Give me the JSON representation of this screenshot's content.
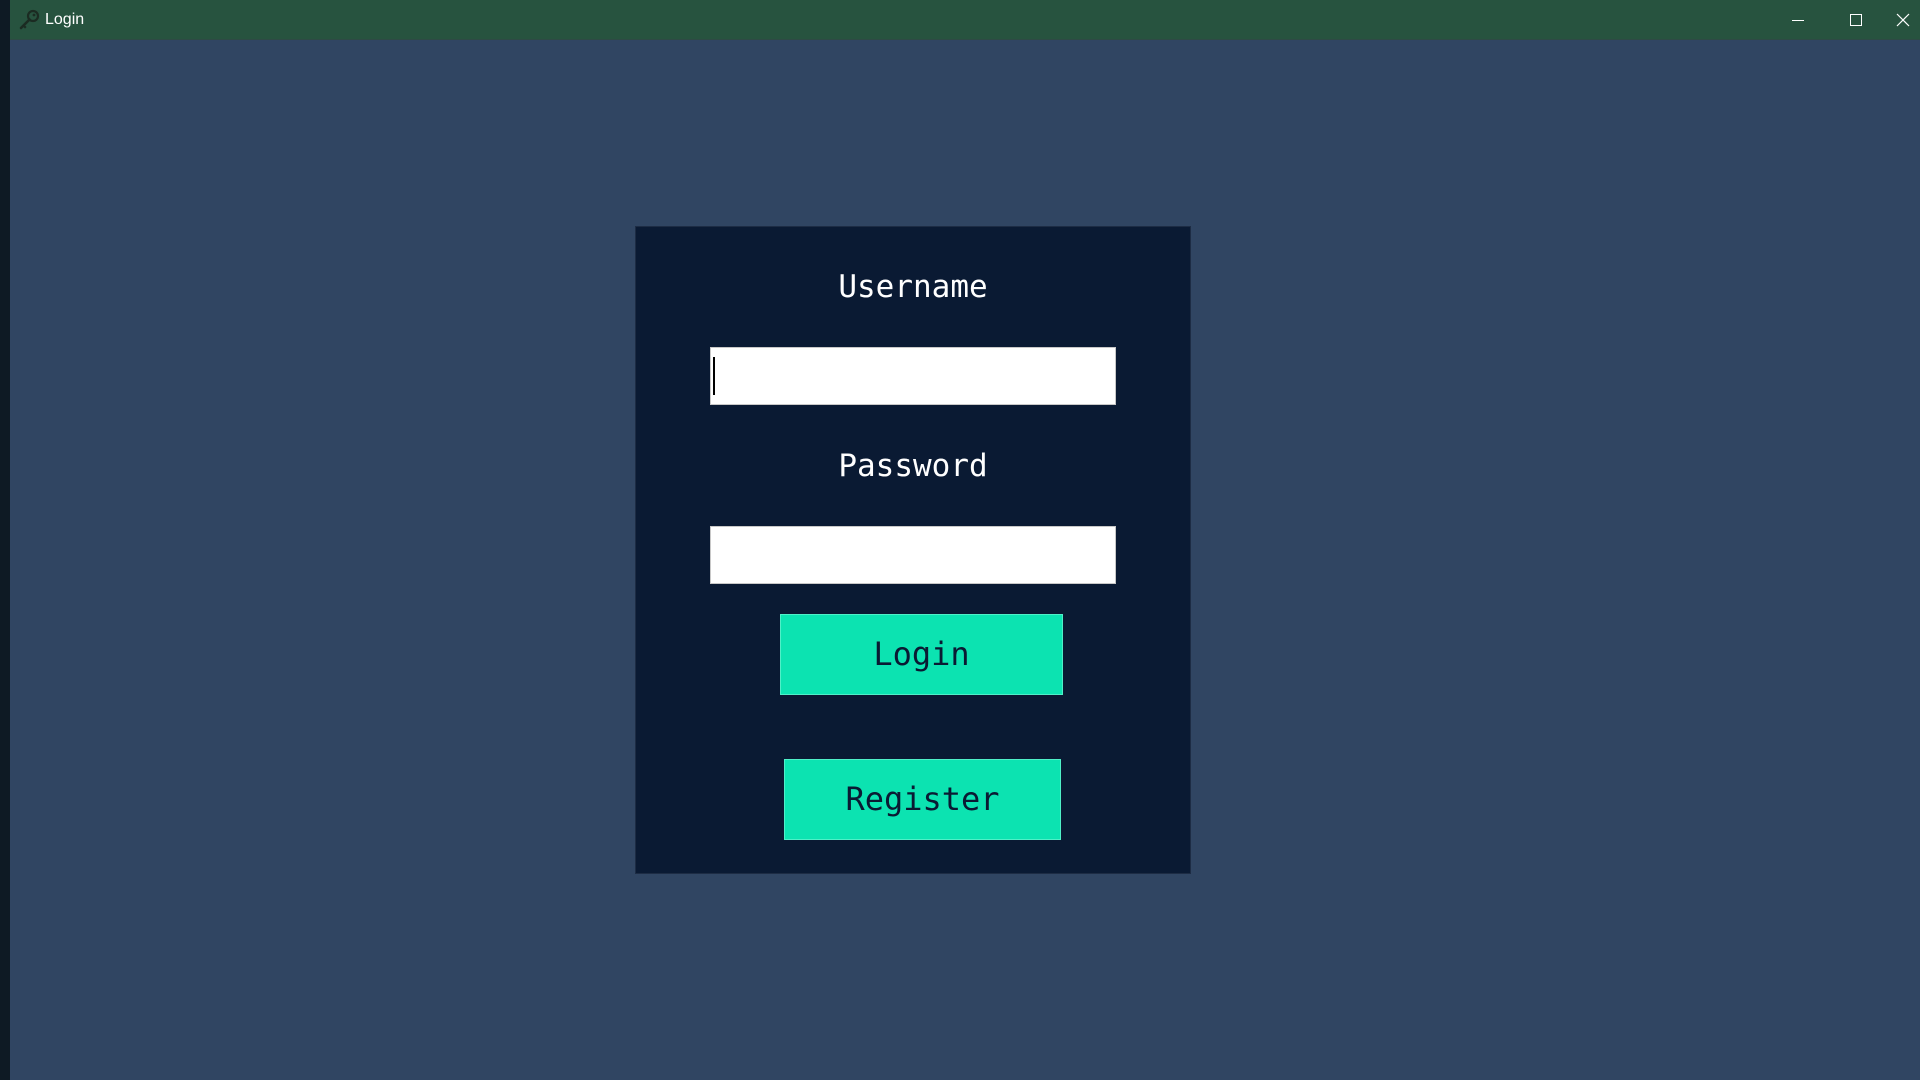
{
  "window": {
    "title": "Login",
    "icon": "key-icon",
    "controls": {
      "minimize": "minimize-icon",
      "maximize": "maximize-icon",
      "close": "close-icon"
    }
  },
  "form": {
    "username_label": "Username",
    "username_value": "",
    "password_label": "Password",
    "password_value": "",
    "login_label": "Login",
    "register_label": "Register"
  },
  "colors": {
    "background": "#304562",
    "panel": "#0a1a33",
    "titlebar": "#27533f",
    "button": "#0ce3b1",
    "button_text": "#0a1a33",
    "label_text": "#ffffff"
  }
}
